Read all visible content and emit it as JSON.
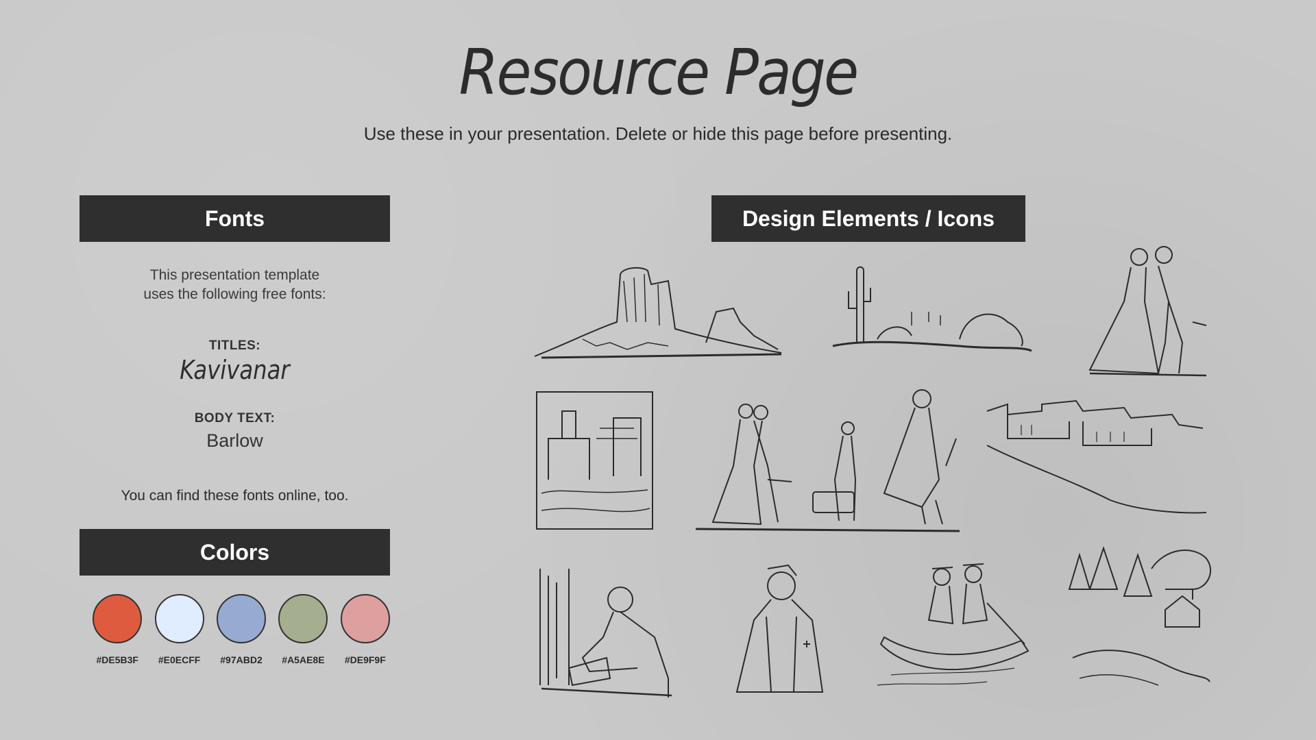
{
  "header": {
    "title": "Resource Page",
    "subtitle": "Use these in your presentation. Delete or hide this page before presenting."
  },
  "fonts": {
    "heading": "Fonts",
    "intro_line1": "This presentation template",
    "intro_line2": "uses the following free fonts:",
    "titles_label": "TITLES:",
    "titles_font": "Kavivanar",
    "body_label": "BODY TEXT:",
    "body_font": "Barlow",
    "footer": "You can find these fonts online, too."
  },
  "colors": {
    "heading": "Colors",
    "swatches": [
      {
        "hex": "#DE5B3F"
      },
      {
        "hex": "#E0ECFF"
      },
      {
        "hex": "#97ABD2"
      },
      {
        "hex": "#A5AE8E"
      },
      {
        "hex": "#DE9F9F"
      }
    ]
  },
  "design": {
    "heading": "Design Elements / Icons",
    "illustrations": [
      "mesa-landscape-illustration",
      "desert-cactus-illustration",
      "victorian-couple-illustration",
      "ancient-city-illustration",
      "walking-travelers-illustration",
      "hillside-palace-illustration",
      "man-writing-illustration",
      "nurse-illustration",
      "canoe-illustration",
      "forest-cabin-illustration"
    ]
  }
}
